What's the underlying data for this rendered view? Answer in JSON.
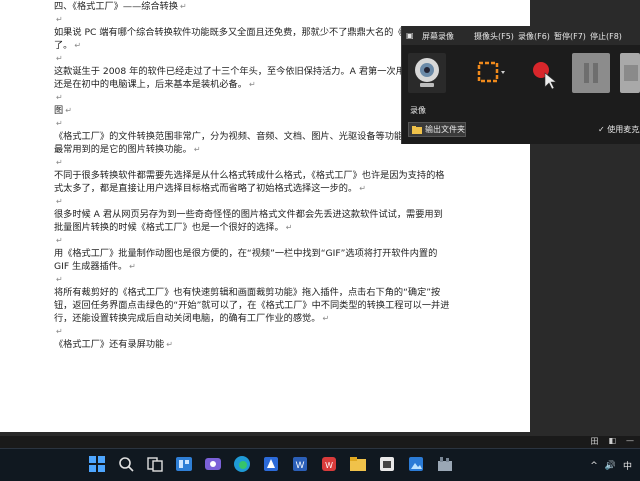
{
  "document": {
    "paragraphs": [
      "四、《格式工厂》——综合转换",
      "",
      "如果说 PC 端有哪个综合转换软件功能既多又全面且还免费，那就少不了鼎鼎大名的《格式工厂》了。",
      "",
      "这款诞生于 2008 年的软件已经走过了十三个年头，至今依旧保持活力。A 君第一次用这款软件还是在初中的电脑课上，后来基本是装机必备。",
      "",
      "图",
      "",
      "《格式工厂》的文件转换范围非常广，分为视频、音频、文档、图片、光驱设备等功能，A 君平时最常用到的是它的图片转换功能。",
      "",
      "不同于很多转换软件都需要先选择是从什么格式转成什么格式，《格式工厂》也许是因为支持的格式太多了，都是直接让用户选择目标格式而省略了初始格式选择这一步的。",
      "",
      "很多时候 A 君从网页另存为到一些奇奇怪怪的图片格式文件都会先丢进这款软件试试，需要用到批量图片转换的时候《格式工厂》也是一个很好的选择。",
      "",
      "用《格式工厂》批量制作动图也是很方便的，在“视频”一栏中找到“GIF”选项将打开软件内置的 GIF 生成器插件。",
      "",
      "将所有裁剪好的《格式工厂》也有快速剪辑和画面裁剪功能》拖入插件，点击右下角的“确定”按钮，返回任务界面点击绿色的“开始”就可以了，在《格式工厂》中不同类型的转换工程可以一并进行，还能设置转换完成后自动关闭电脑，的确有工厂作业的感觉。",
      "",
      "《格式工厂》还有录屏功能"
    ],
    "para_mark": "↵"
  },
  "recorder": {
    "menu": [
      "屏幕录像",
      "摄像头(F5)",
      "录像(F6)",
      "暂停(F7)",
      "停止(F8)"
    ],
    "section_label": "录像",
    "output_button": "输出文件夹",
    "use_mouse_label": "✓ 使用麦克风",
    "tools": [
      "webcam-icon",
      "region-select-icon",
      "cursor-record-icon",
      "pause-icon",
      "stop-icon"
    ]
  },
  "statusbar": {
    "items": [
      "田",
      "◧",
      "—"
    ]
  },
  "taskbar": {
    "icons": [
      "windows-start-icon",
      "search-icon",
      "task-view-icon",
      "widgets-icon",
      "chat-icon",
      "edge-icon",
      "app-icon",
      "word-icon",
      "wps-icon",
      "files-icon",
      "store-icon",
      "photos-icon",
      "format-factory-icon"
    ],
    "tray": [
      "^",
      "🔊",
      "中"
    ]
  }
}
